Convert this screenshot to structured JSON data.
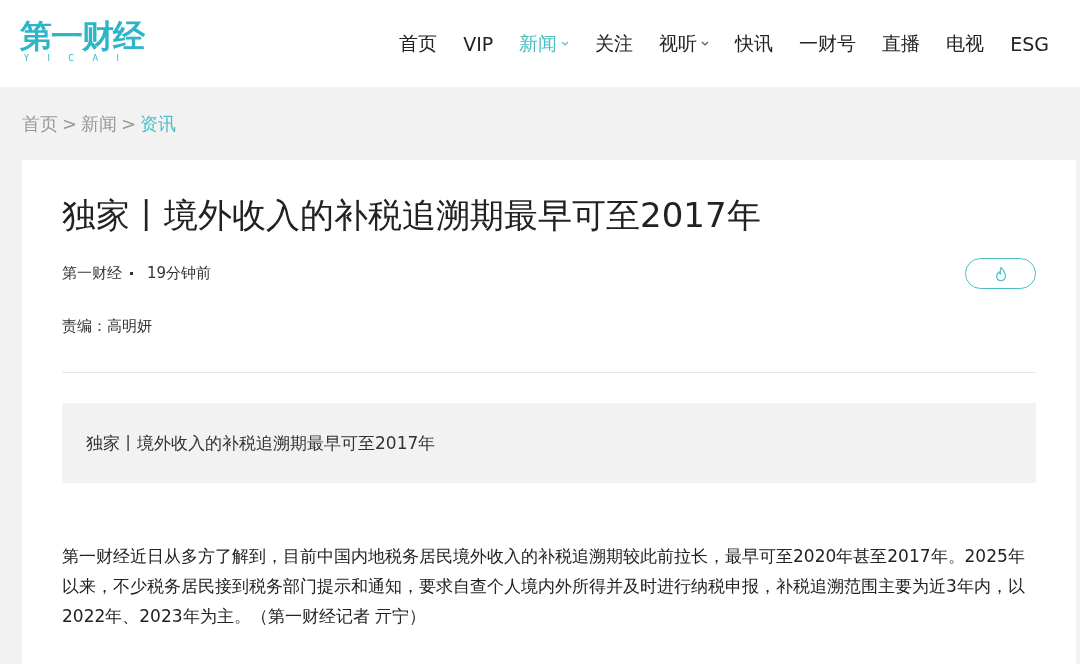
{
  "header": {
    "logo": {
      "text": "第一财经",
      "subtext": "Y I C A I"
    },
    "nav": [
      {
        "label": "首页",
        "selected": false,
        "dropdown": false
      },
      {
        "label": "VIP",
        "selected": false,
        "dropdown": false
      },
      {
        "label": "新闻",
        "selected": true,
        "dropdown": true
      },
      {
        "label": "关注",
        "selected": false,
        "dropdown": false
      },
      {
        "label": "视听",
        "selected": false,
        "dropdown": true
      },
      {
        "label": "快讯",
        "selected": false,
        "dropdown": false
      },
      {
        "label": "一财号",
        "selected": false,
        "dropdown": false
      },
      {
        "label": "直播",
        "selected": false,
        "dropdown": false
      },
      {
        "label": "电视",
        "selected": false,
        "dropdown": false
      },
      {
        "label": "ESG",
        "selected": false,
        "dropdown": false
      }
    ]
  },
  "breadcrumb": [
    {
      "label": "首页",
      "selected": false
    },
    {
      "label": "新闻",
      "selected": false
    },
    {
      "label": "资讯",
      "selected": true
    }
  ],
  "breadcrumb_separator": ">",
  "article": {
    "title": "独家丨境外收入的补税追溯期最早可至2017年",
    "source": "第一财经",
    "time": "19分钟前",
    "editor": "责编：高明妍",
    "summary": "独家丨境外收入的补税追溯期最早可至2017年",
    "body": "第一财经近日从多方了解到，目前中国内地税务居民境外收入的补税追溯期较此前拉长，最早可至2020年甚至2017年。2025年以来，不少税务居民接到税务部门提示和通知，要求自查个人境内外所得并及时进行纳税申报，补税追溯范围主要为近3年内，以2022年、2023年为主。（第一财经记者 亓宁）"
  }
}
